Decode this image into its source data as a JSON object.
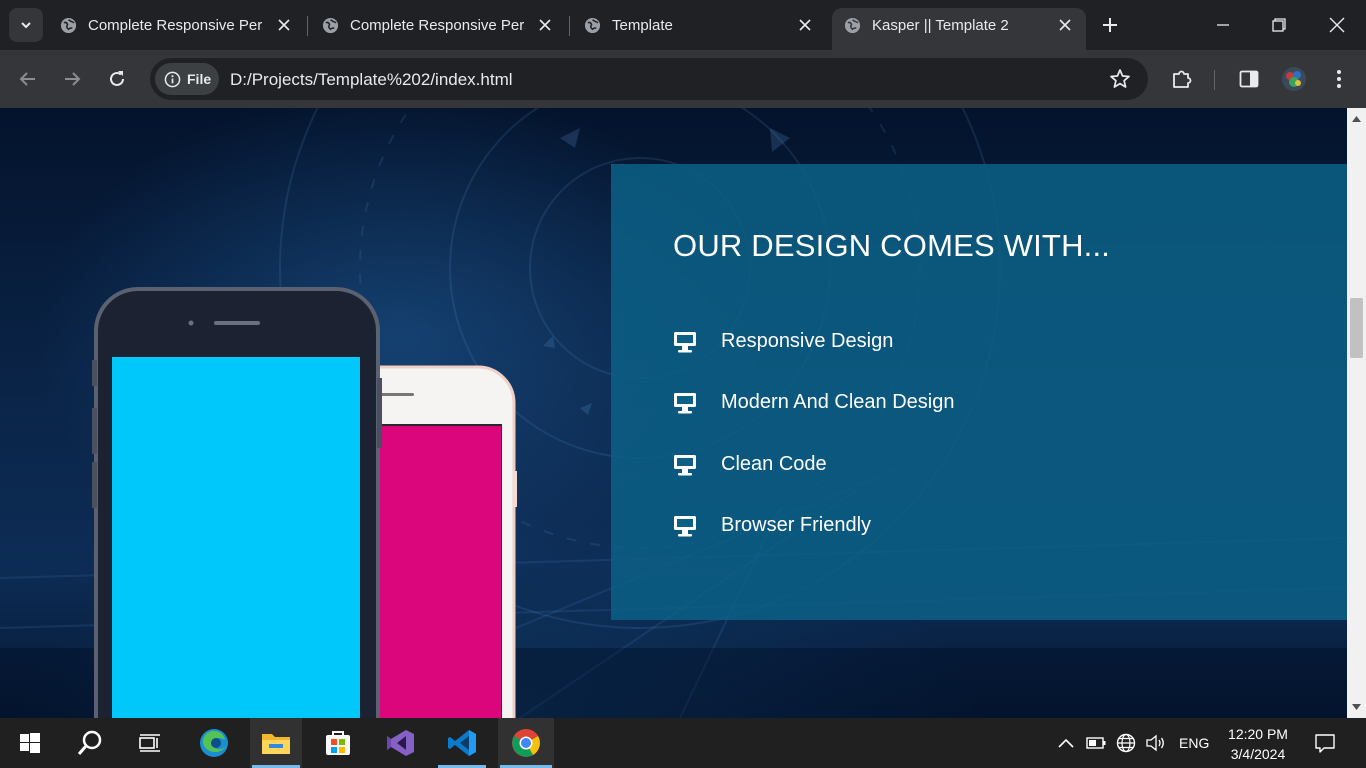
{
  "browser": {
    "tabs": [
      {
        "title": "Complete Responsive Pers",
        "active": false,
        "icon": "globe-icon"
      },
      {
        "title": "Complete Responsive Pers",
        "active": false,
        "icon": "globe-icon"
      },
      {
        "title": "Template",
        "active": false,
        "icon": "globe-icon"
      },
      {
        "title": "Kasper || Template 2",
        "active": true,
        "icon": "globe-icon"
      }
    ],
    "address": {
      "scheme_chip": "File",
      "url": "D:/Projects/Template%202/index.html"
    }
  },
  "page": {
    "section_title": "OUR DESIGN COMES WITH...",
    "features": [
      {
        "label": "Responsive Design",
        "icon": "monitor-icon"
      },
      {
        "label": "Modern And Clean Design",
        "icon": "monitor-icon"
      },
      {
        "label": "Clean Code",
        "icon": "monitor-icon"
      },
      {
        "label": "Browser Friendly",
        "icon": "monitor-icon"
      }
    ],
    "colors": {
      "panel": "#0c6086",
      "phone_front_screen": "#00c8fb",
      "phone_back_screen": "#dc067c"
    }
  },
  "taskbar": {
    "apps": [
      "start-icon",
      "search-icon",
      "task-view-icon",
      "edge-icon",
      "file-explorer-icon",
      "store-icon",
      "visual-studio-icon",
      "vscode-icon",
      "chrome-icon"
    ],
    "language": "ENG",
    "time": "12:20 PM",
    "date": "3/4/2024"
  }
}
